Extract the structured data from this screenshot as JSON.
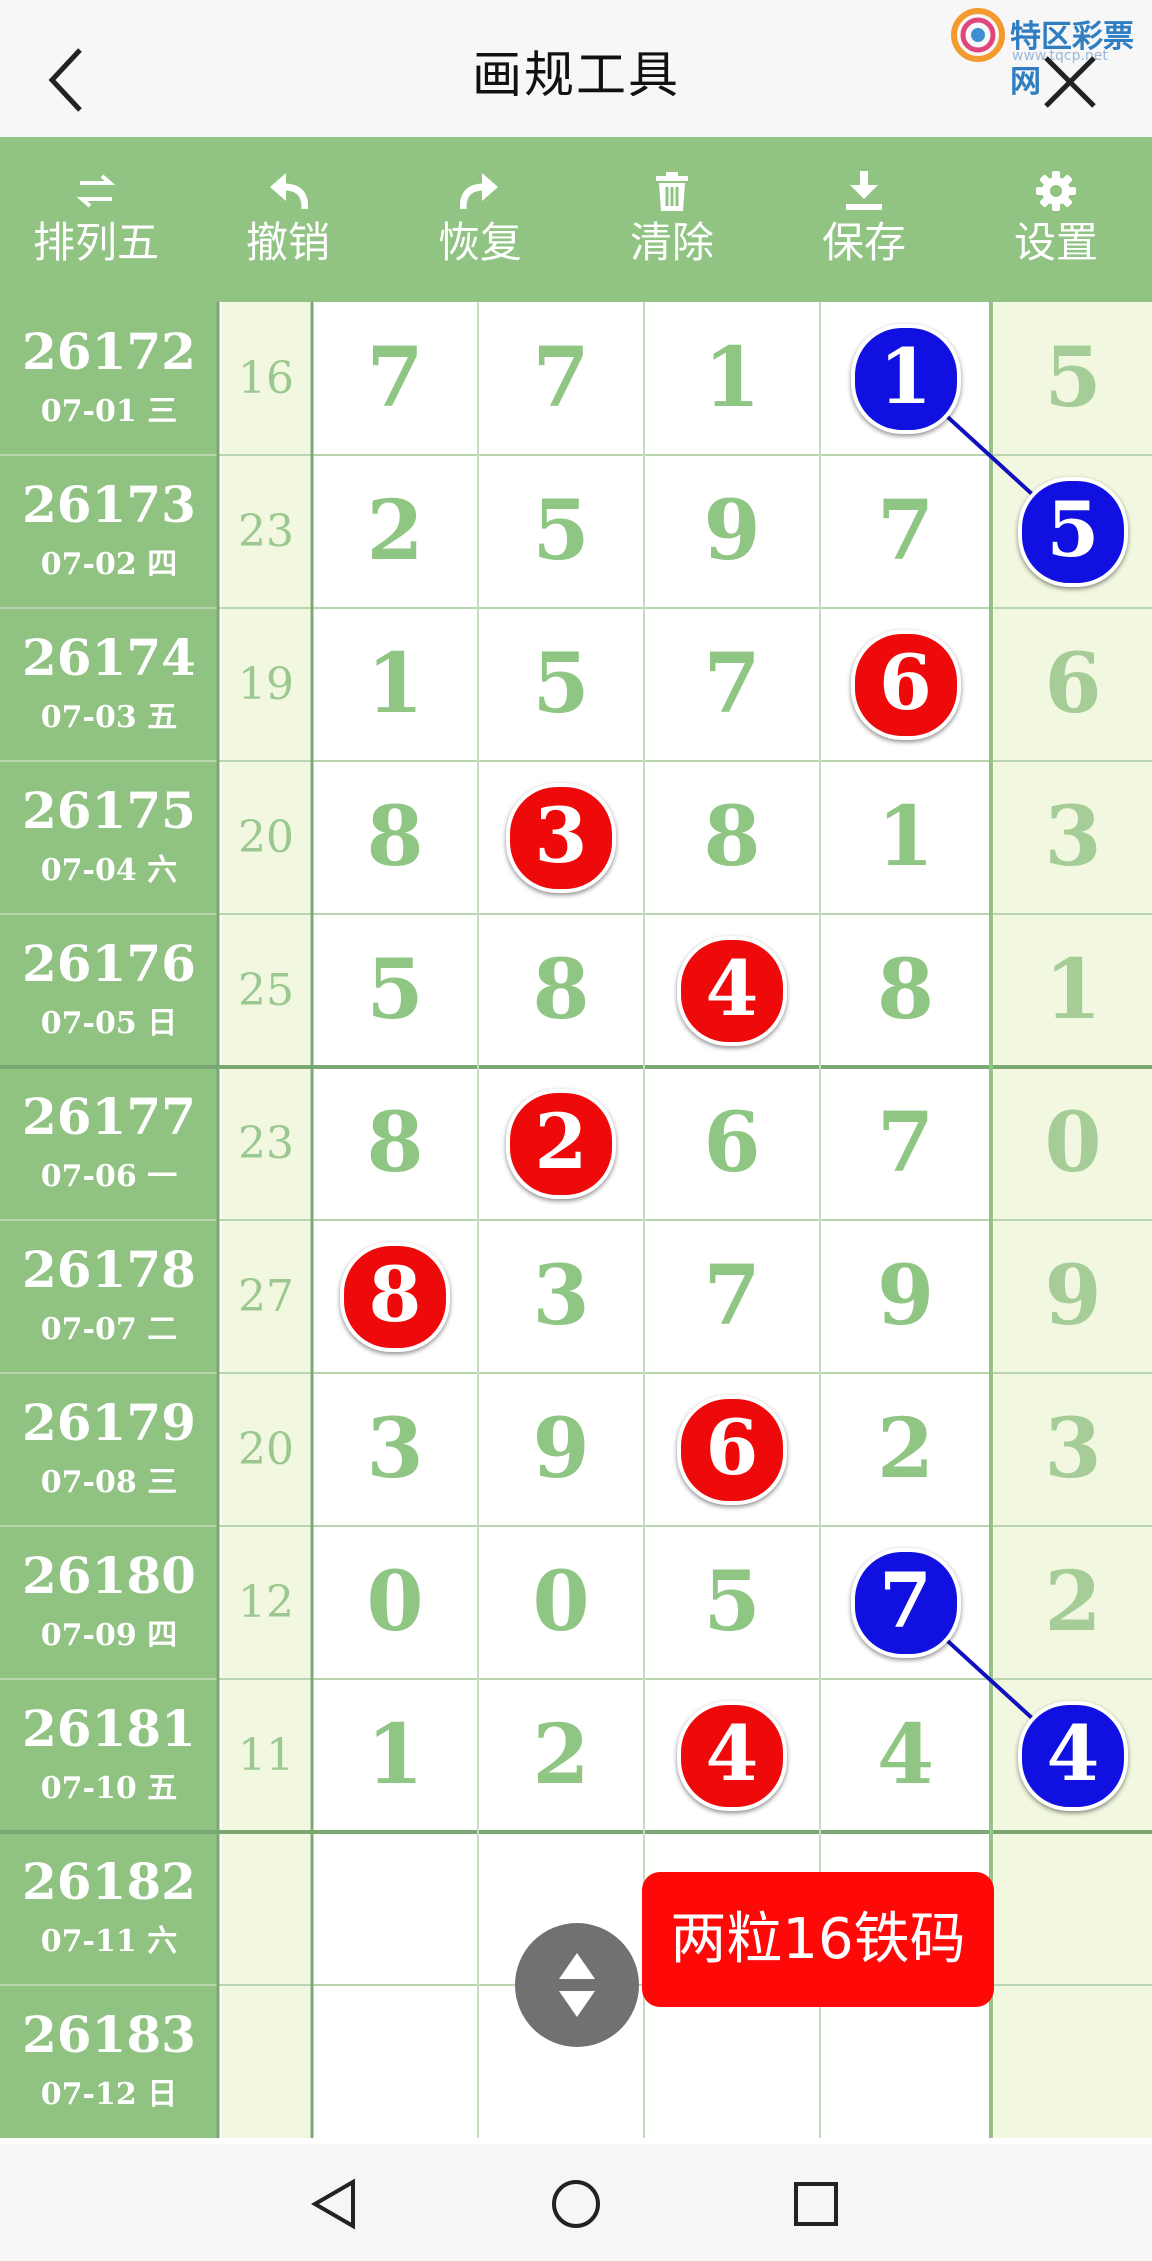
{
  "header": {
    "title": "画规工具",
    "logo_text": "特区彩票网",
    "logo_sub": "www.tqcp.net"
  },
  "toolbar": [
    {
      "icon": "swap-arrows-icon",
      "label": "排列五"
    },
    {
      "icon": "undo-icon",
      "label": "撤销"
    },
    {
      "icon": "redo-icon",
      "label": "恢复"
    },
    {
      "icon": "trash-icon",
      "label": "清除"
    },
    {
      "icon": "download-icon",
      "label": "保存"
    },
    {
      "icon": "gear-icon",
      "label": "设置"
    }
  ],
  "rows": [
    {
      "issue": "26172",
      "date": "07-01 三",
      "sum": "16",
      "digits": [
        "7",
        "7",
        "1",
        "1",
        "5"
      ]
    },
    {
      "issue": "26173",
      "date": "07-02 四",
      "sum": "23",
      "digits": [
        "2",
        "5",
        "9",
        "7",
        "5"
      ]
    },
    {
      "issue": "26174",
      "date": "07-03 五",
      "sum": "19",
      "digits": [
        "1",
        "5",
        "7",
        "6",
        "6"
      ]
    },
    {
      "issue": "26175",
      "date": "07-04 六",
      "sum": "20",
      "digits": [
        "8",
        "3",
        "8",
        "1",
        "3"
      ]
    },
    {
      "issue": "26176",
      "date": "07-05 日",
      "sum": "25",
      "digits": [
        "5",
        "8",
        "4",
        "8",
        "1"
      ]
    },
    {
      "issue": "26177",
      "date": "07-06 一",
      "sum": "23",
      "digits": [
        "8",
        "2",
        "6",
        "7",
        "0"
      ]
    },
    {
      "issue": "26178",
      "date": "07-07 二",
      "sum": "27",
      "digits": [
        "8",
        "3",
        "7",
        "9",
        "9"
      ]
    },
    {
      "issue": "26179",
      "date": "07-08 三",
      "sum": "20",
      "digits": [
        "3",
        "9",
        "6",
        "2",
        "3"
      ]
    },
    {
      "issue": "26180",
      "date": "07-09 四",
      "sum": "12",
      "digits": [
        "0",
        "0",
        "5",
        "7",
        "2"
      ]
    },
    {
      "issue": "26181",
      "date": "07-10 五",
      "sum": "11",
      "digits": [
        "1",
        "2",
        "4",
        "4",
        "4"
      ]
    },
    {
      "issue": "26182",
      "date": "07-11 六",
      "sum": "",
      "digits": [
        "",
        "",
        "",
        "",
        ""
      ]
    },
    {
      "issue": "26183",
      "date": "07-12 日",
      "sum": "",
      "digits": [
        "",
        "",
        "",
        "",
        ""
      ]
    }
  ],
  "marks": [
    {
      "row": 0,
      "col": 3,
      "value": "1",
      "color": "#1010e0"
    },
    {
      "row": 1,
      "col": 4,
      "value": "5",
      "color": "#1010e0"
    },
    {
      "row": 2,
      "col": 3,
      "value": "6",
      "color": "#ee0a0a"
    },
    {
      "row": 3,
      "col": 1,
      "value": "3",
      "color": "#ee0a0a"
    },
    {
      "row": 4,
      "col": 2,
      "value": "4",
      "color": "#ee0a0a"
    },
    {
      "row": 5,
      "col": 1,
      "value": "2",
      "color": "#ee0a0a"
    },
    {
      "row": 6,
      "col": 0,
      "value": "8",
      "color": "#ee0a0a"
    },
    {
      "row": 7,
      "col": 2,
      "value": "6",
      "color": "#ee0a0a"
    },
    {
      "row": 8,
      "col": 3,
      "value": "7",
      "color": "#1010e0"
    },
    {
      "row": 9,
      "col": 4,
      "value": "4",
      "color": "#1010e0"
    },
    {
      "row": 9,
      "col": 2,
      "value": "4",
      "color": "#ee0a0a"
    }
  ],
  "links": [
    {
      "from": [
        0,
        3
      ],
      "to": [
        1,
        4
      ],
      "color": "#1010c0"
    },
    {
      "from": [
        8,
        3
      ],
      "to": [
        9,
        4
      ],
      "color": "#1010c0"
    }
  ],
  "note": "两粒16铁码",
  "nav": [
    "back-triangle-icon",
    "home-circle-icon",
    "recents-square-icon"
  ]
}
